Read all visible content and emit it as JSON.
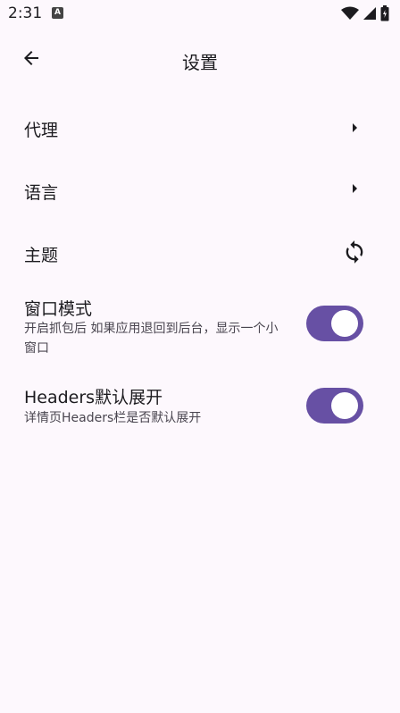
{
  "status_bar": {
    "time": "2:31",
    "app_icon_letter": "A",
    "icons": [
      "wifi-icon",
      "cell-signal-icon",
      "battery-icon"
    ]
  },
  "app_bar": {
    "back_icon": "arrow-back-icon",
    "title": "设置"
  },
  "settings": {
    "proxy": {
      "label": "代理",
      "icon": "arrow-right-icon"
    },
    "language": {
      "label": "语言",
      "icon": "arrow-right-icon"
    },
    "theme": {
      "label": "主题",
      "icon": "sync-icon"
    },
    "window_mode": {
      "label": "窗口模式",
      "description": "开启抓包后 如果应用退回到后台，显示一个小窗口",
      "enabled": true
    },
    "headers_expand": {
      "label": "Headers默认展开",
      "description": "详情页Headers栏是否默认展开",
      "enabled": true
    }
  },
  "colors": {
    "background": "#fdf8fd",
    "accent": "#6750a4",
    "text_primary": "#1c1b1f",
    "text_secondary": "#49454f"
  }
}
